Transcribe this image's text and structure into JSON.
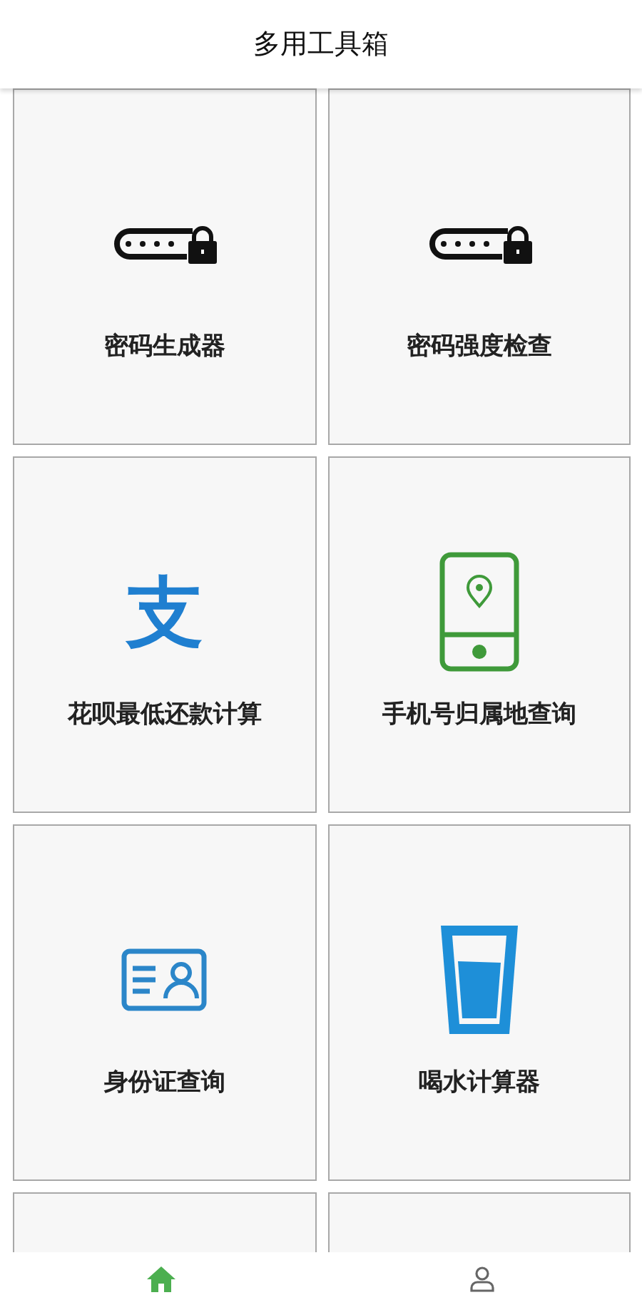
{
  "header": {
    "title": "多用工具箱"
  },
  "tools": [
    {
      "kind": "password",
      "label": "密码生成器"
    },
    {
      "kind": "password",
      "label": "密码强度检查"
    },
    {
      "kind": "glyph",
      "glyph": "支",
      "label": "花呗最低还款计算"
    },
    {
      "kind": "phone-location",
      "label": "手机号归属地查询"
    },
    {
      "kind": "id-card",
      "label": "身份证查询"
    },
    {
      "kind": "water",
      "label": "喝水计算器"
    },
    {
      "kind": "blank"
    },
    {
      "kind": "blank"
    }
  ],
  "nav": [
    {
      "kind": "home",
      "selected": true
    },
    {
      "kind": "person",
      "selected": false
    }
  ]
}
